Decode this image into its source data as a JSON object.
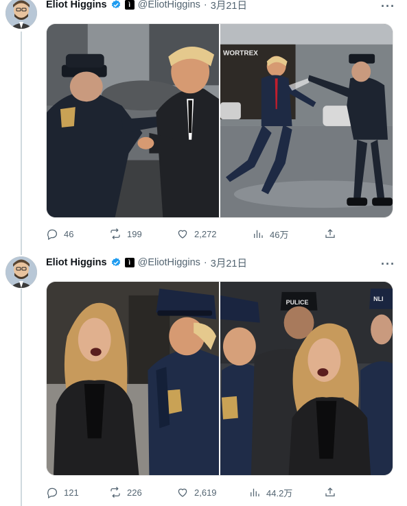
{
  "tweets": [
    {
      "author": {
        "name": "Eliot Higgins",
        "handle": "@EliotHiggins",
        "affiliate_badge": "ì"
      },
      "separator": "·",
      "date": "3月21日",
      "more_label": "···",
      "images": [
        {
          "alt": "Police officer confronting man in suit on street"
        },
        {
          "alt": "Man in suit running from police officer on wet street",
          "sign_text": "WORTREX"
        }
      ],
      "stats": {
        "replies": "46",
        "retweets": "199",
        "likes": "2,272",
        "views": "46万"
      }
    },
    {
      "author": {
        "name": "Eliot Higgins",
        "handle": "@EliotHiggins",
        "affiliate_badge": "ì"
      },
      "separator": "·",
      "date": "3月21日",
      "more_label": "···",
      "images": [
        {
          "alt": "Woman in leather jacket shouting at police officer"
        },
        {
          "alt": "Woman shouting among police officers",
          "cap_text_1": "PULICE",
          "cap_text_2": "NLI"
        }
      ],
      "stats": {
        "replies": "121",
        "retweets": "226",
        "likes": "2,619",
        "views": "44.2万"
      }
    }
  ],
  "colors": {
    "verified": "#1d9bf0",
    "muted": "#536471",
    "thread_line": "#cfd9de"
  }
}
